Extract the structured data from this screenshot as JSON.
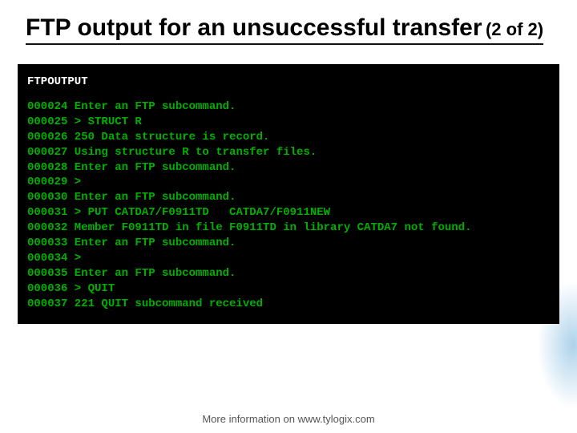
{
  "title": {
    "main": "FTP output for an unsuccessful transfer",
    "sub": "(2 of 2)"
  },
  "terminal": {
    "label": "FTPOUTPUT",
    "lines": [
      {
        "num": "000024",
        "text": "Enter an FTP subcommand."
      },
      {
        "num": "000025",
        "text": "> STRUCT R"
      },
      {
        "num": "000026",
        "text": "250 Data structure is record."
      },
      {
        "num": "000027",
        "text": "Using structure R to transfer files."
      },
      {
        "num": "000028",
        "text": "Enter an FTP subcommand."
      },
      {
        "num": "000029",
        "text": ">"
      },
      {
        "num": "000030",
        "text": "Enter an FTP subcommand."
      },
      {
        "num": "000031",
        "text": "> PUT CATDA7/F0911TD   CATDA7/F0911NEW"
      },
      {
        "num": "000032",
        "text": "Member F0911TD in file F0911TD in library CATDA7 not found."
      },
      {
        "num": "000033",
        "text": "Enter an FTP subcommand."
      },
      {
        "num": "000034",
        "text": ">"
      },
      {
        "num": "000035",
        "text": "Enter an FTP subcommand."
      },
      {
        "num": "000036",
        "text": "> QUIT"
      },
      {
        "num": "000037",
        "text": "221 QUIT subcommand received"
      }
    ]
  },
  "footer": "More information on www.tylogix.com"
}
